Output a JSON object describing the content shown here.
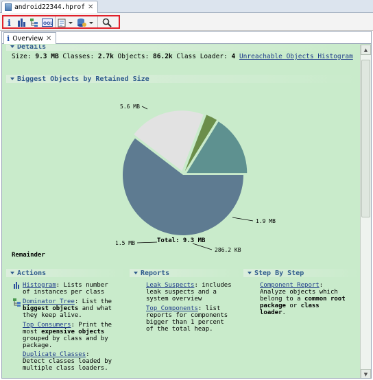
{
  "editor": {
    "tab_label": "android22344.hprof"
  },
  "toolbar": {
    "buttons": [
      {
        "name": "overview-button",
        "icon": "info-icon"
      },
      {
        "name": "histogram-button",
        "icon": "histogram-icon"
      },
      {
        "name": "dominator-tree-button",
        "icon": "dominator-tree-icon"
      },
      {
        "name": "oql-button",
        "icon": "oql-icon",
        "text": "OQL"
      },
      {
        "name": "run-report-button",
        "icon": "report-icon"
      },
      {
        "name": "query-browser-button",
        "icon": "database-icon"
      },
      {
        "name": "search-button",
        "icon": "search-icon"
      }
    ]
  },
  "view": {
    "tab_label": "Overview"
  },
  "details": {
    "header": "Details",
    "size_label": "Size:",
    "size_value": "9.3 MB",
    "classes_label": "Classes:",
    "classes_value": "2.7k",
    "objects_label": "Objects:",
    "objects_value": "86.2k",
    "loader_label": "Class Loader:",
    "loader_value": "4",
    "link": "Unreachable Objects Histogram"
  },
  "biggest": {
    "header": "Biggest Objects by Retained Size",
    "total_label": "Total: 9.3 MB",
    "remainder": "Remainder"
  },
  "chart_data": {
    "type": "pie",
    "title": "Biggest Objects by Retained Size",
    "slices": [
      {
        "label": "5.6 MB",
        "value": 5.6,
        "color": "#5e7b91"
      },
      {
        "label": "1.9 MB",
        "value": 1.9,
        "color": "#e2e2e2"
      },
      {
        "label": "286.2 KB",
        "value": 0.28,
        "color": "#6b8e4a"
      },
      {
        "label": "1.5 MB",
        "value": 1.5,
        "color": "#5e9190"
      }
    ],
    "total": "Total: 9.3 MB"
  },
  "actions": {
    "header": "Actions",
    "items": [
      {
        "link": "Histogram",
        "rest": ": Lists number of instances per class"
      },
      {
        "link": "Dominator Tree",
        "rest_pre": ": List the ",
        "bold": "biggest objects",
        "rest": " and what they keep alive."
      },
      {
        "link": "Top Consumers",
        "rest_pre": ": Print the most ",
        "bold": "expensive objects",
        "rest": " grouped by class and by package."
      },
      {
        "link": "Duplicate Classes",
        "rest": ": Detect classes loaded by multiple class loaders."
      }
    ]
  },
  "reports": {
    "header": "Reports",
    "items": [
      {
        "link": "Leak Suspects",
        "rest": ": includes leak suspects and a system overview"
      },
      {
        "link": "Top Components",
        "rest": ": list reports for components bigger than 1 percent of the total heap."
      }
    ]
  },
  "step": {
    "header": "Step By Step",
    "link": "Component Report",
    "rest_pre": ": Analyze objects which belong to a ",
    "bold1": "common root package",
    "mid": " or ",
    "bold2": "class loader",
    "end": "."
  }
}
